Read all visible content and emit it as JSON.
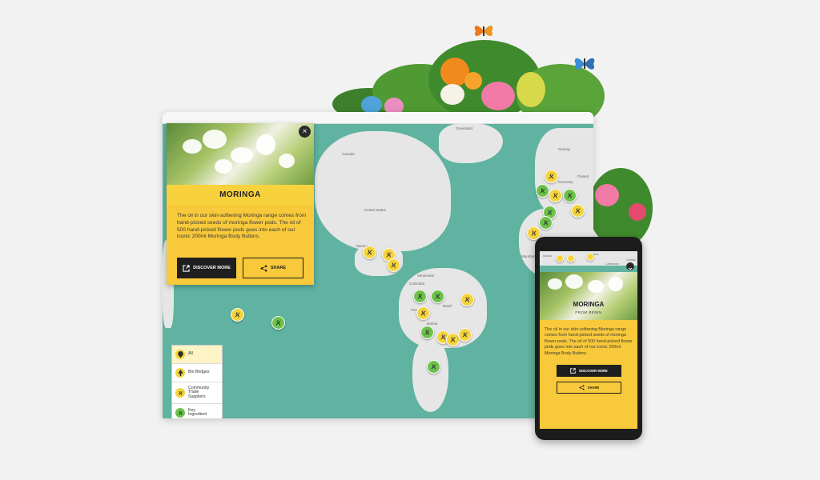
{
  "desktop": {
    "card": {
      "title": "MORINGA",
      "description": "The oil in our skin-softening Moringa range comes from hand-picked seeds of moringa flower pods. The oil of 500 hand-picked flower pods goes into each of our iconic 200ml Moringa Body Butters.",
      "discover_label": "DISCOVER MORE",
      "share_label": "SHARE",
      "close_symbol": "×"
    },
    "legend": [
      {
        "label": "All",
        "icon": "location-pin-icon",
        "color": "#f5d33b"
      },
      {
        "label": "Bio Bridges",
        "icon": "tree-icon",
        "color": "#f5d33b"
      },
      {
        "label": "Community Trade Suppliers",
        "icon": "leaf-hand-icon",
        "color": "#f5d33b"
      },
      {
        "label": "Key Ingredient",
        "icon": "leaf-hand-icon",
        "color": "#6cc24a"
      }
    ],
    "map_labels": {
      "greenland": "Greenland",
      "canada": "Canada",
      "united_states": "United States",
      "mexico": "Mexico",
      "venezuela": "Venezuela",
      "colombia": "Colombia",
      "peru": "Peru",
      "bolivia": "Bolivia",
      "brazil": "Brazil",
      "norway": "Norway",
      "germany": "Germany",
      "poland": "Poland",
      "algeria": "Algeria",
      "mauritania": "Mauritania"
    }
  },
  "mobile": {
    "title": "MORINGA",
    "subtitle": "FROM BENIN",
    "description": "The oil in our skin-softening Moringa range comes from hand-picked seeds of moringa flower pods. The oil of 500 hand-picked flower pods goes into each of our iconic 200ml Moringa Body Butters.",
    "discover_label": "DISCOVER MORE",
    "share_label": "SHARE",
    "map_labels": {
      "nigeria": "Nigeria",
      "cameroon": "Cameroon",
      "central": "Central",
      "ghana": "Ghana"
    }
  },
  "colors": {
    "accent_yellow": "#f8c93a",
    "marker_yellow": "#f5d33b",
    "marker_green": "#6cc24a",
    "ocean": "#5fb3a0",
    "land": "#e6e6e6",
    "dark_button": "#1f1f1f"
  }
}
